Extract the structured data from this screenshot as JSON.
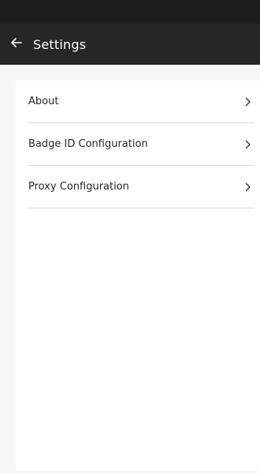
{
  "app_bar": {
    "title": "Settings",
    "back_icon": "arrow-left-icon"
  },
  "settings": {
    "items": [
      {
        "label": "About",
        "icon": "chevron-right-icon"
      },
      {
        "label": "Badge ID Configuration",
        "icon": "chevron-right-icon"
      },
      {
        "label": "Proxy Configuration",
        "icon": "chevron-right-icon"
      }
    ]
  },
  "colors": {
    "status_bar": "#1b1d20",
    "app_bar": "#25272b",
    "background": "#f6f7f9",
    "panel": "#ffffff",
    "divider": "#d9dbe0",
    "text": "#23272d"
  }
}
